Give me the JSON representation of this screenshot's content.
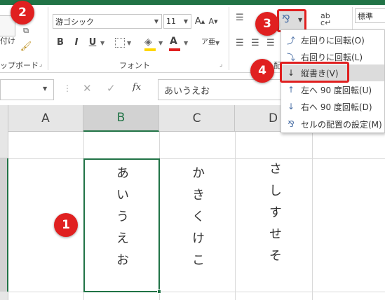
{
  "ribbon": {
    "clipboard": {
      "paste_label": "付け",
      "group_label": "ップボード"
    },
    "font": {
      "font_name": "游ゴシック",
      "font_size": "11",
      "bold": "B",
      "italic": "I",
      "underline": "U",
      "grow": "A",
      "shrink": "A",
      "font_color": "A",
      "group_label": "フォント"
    },
    "alignment": {
      "group_label_fragment": "配"
    },
    "number": {
      "format": "標準"
    }
  },
  "formula_bar": {
    "fx_label": "fx",
    "cancel": "✕",
    "enter": "✓",
    "content": "あいうえお"
  },
  "grid": {
    "columns": [
      "A",
      "B",
      "C",
      "D"
    ],
    "cells": {
      "B": "あいうえお",
      "C": "かきくけこ",
      "D": "さしすせそ"
    }
  },
  "orientation_menu": {
    "items": [
      {
        "label": "左回りに回転(O)",
        "icon": "rotate-left-icon"
      },
      {
        "label": "右回りに回転(L)",
        "icon": "rotate-right-icon"
      },
      {
        "label": "縦書き(V)",
        "icon": "vertical-text-icon"
      },
      {
        "label": "左へ 90 度回転(U)",
        "icon": "rotate-up-icon"
      },
      {
        "label": "右へ 90 度回転(D)",
        "icon": "rotate-down-icon"
      },
      {
        "label": "セルの配置の設定(M)",
        "icon": "format-alignment-icon"
      }
    ]
  },
  "annotations": {
    "badge1": "1",
    "badge2": "2",
    "badge3": "3",
    "badge4": "4"
  },
  "colors": {
    "badge": "#e02020",
    "accent_green": "#217346",
    "selection": "#217346"
  }
}
